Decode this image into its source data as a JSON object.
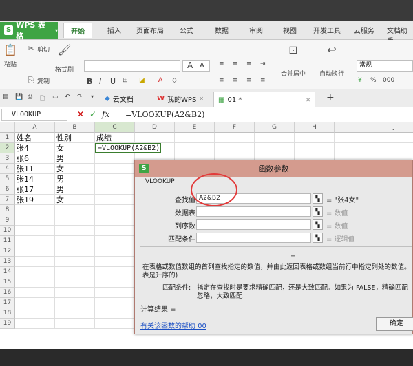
{
  "app": {
    "title": "WPS 表格"
  },
  "menu_tabs": [
    "开始",
    "插入",
    "页面布局",
    "公式",
    "数据",
    "审阅",
    "视图",
    "开发工具",
    "云服务",
    "文档助手"
  ],
  "active_tab": "开始",
  "ribbon": {
    "cut": "剪切",
    "paste": "粘贴",
    "copy": "复制",
    "format_painter": "格式刷",
    "bold": "B",
    "italic": "I",
    "underline": "U",
    "merge": "合并居中",
    "wrap": "自动换行",
    "number_format": "常规",
    "percent": "%",
    "thousands": "000",
    "font_grow": "A",
    "font_shrink": "A"
  },
  "doc_tabs": {
    "cloud": "云文档",
    "mywps": "我的WPS",
    "file": "01 *",
    "add": "+"
  },
  "formula_bar": {
    "name_box": "VLOOKUP",
    "cancel": "✕",
    "confirm": "✓",
    "fx": "fx",
    "formula": "=VLOOKUP(A2&B2)"
  },
  "columns": [
    "A",
    "B",
    "C",
    "D",
    "E",
    "F",
    "G",
    "H",
    "I",
    "J"
  ],
  "rows": [
    "1",
    "2",
    "3",
    "4",
    "5",
    "6",
    "7",
    "8",
    "9",
    "10",
    "11",
    "12",
    "13",
    "14",
    "15",
    "16",
    "17",
    "18",
    "19"
  ],
  "cells": {
    "A1": "姓名",
    "B1": "性别",
    "C1": "成绩",
    "A2": "张4",
    "B2": "女",
    "C2": "=VLOOKUP(A2&B2)",
    "A3": "张6",
    "B3": "男",
    "A4": "张11",
    "B4": "女",
    "A5": "张14",
    "B5": "男",
    "A6": "张17",
    "B6": "男",
    "A7": "张19",
    "B7": "女"
  },
  "dialog": {
    "title": "函数参数",
    "group": "VLOOKUP",
    "args": [
      {
        "label": "查找值",
        "value": "A2&B2",
        "result": "= \"张4女\""
      },
      {
        "label": "数据表",
        "value": "",
        "result": "= 数值"
      },
      {
        "label": "列序数",
        "value": "",
        "result": "= 数值"
      },
      {
        "label": "匹配条件",
        "value": "",
        "result": "= 逻辑值"
      }
    ],
    "equals": "=",
    "description_1": "在表格或数值数组的首列查找指定的数值，并由此返回表格或数组当前行中指定列处的数值。",
    "description_2": "表是升序的)",
    "param_label": "匹配条件:",
    "param_text_1": "指定在查找时是要求精确匹配，还是大致匹配。如果为 FALSE，精确匹配",
    "param_text_2": "忽略，大致匹配",
    "result_label": "计算结果 =",
    "help_link": "有关该函数的帮助 00",
    "ok": "确定"
  },
  "colors": {
    "accent": "#3ea444",
    "dialog_title": "#d49b8e",
    "circle": "#e23a3a",
    "link": "#1a4fc4"
  }
}
